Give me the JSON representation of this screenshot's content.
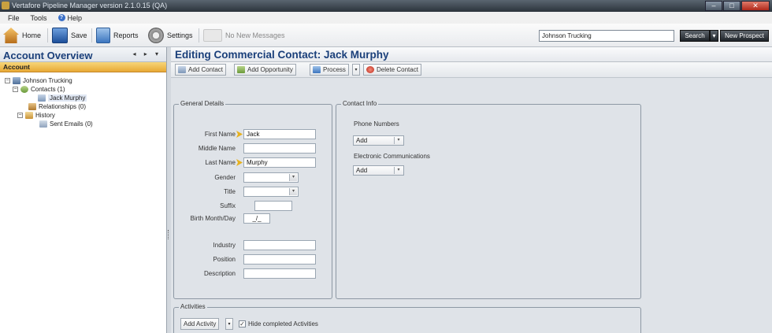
{
  "window": {
    "title": "Vertafore Pipeline Manager version 2.1.0.15 (QA)",
    "controls": {
      "minimize": "–",
      "maximize": "□",
      "close": "✕"
    }
  },
  "menu": {
    "items": [
      "File",
      "Tools",
      "Help"
    ]
  },
  "toolbar": {
    "home": "Home",
    "save": "Save",
    "reports": "Reports",
    "settings": "Settings",
    "messages": "No New Messages",
    "search_value": "Johnson Trucking",
    "search_button": "Search",
    "search_dropdown": "▾",
    "new_prospect": "New Prospect"
  },
  "left_panel": {
    "title": "Account Overview",
    "nav_arrows": "◂ ▸ ▾",
    "section": "Account",
    "tree": {
      "root": "Johnson Trucking",
      "contacts": "Contacts (1)",
      "contact_item": "Jack Murphy",
      "relationships": "Relationships (0)",
      "history": "History",
      "sent_emails": "Sent Emails (0)"
    }
  },
  "main": {
    "title": "Editing Commercial Contact: Jack Murphy",
    "actions": {
      "add_contact": "Add Contact",
      "add_opportunity": "Add Opportunity",
      "process": "Process",
      "process_dropdown": "▾",
      "delete_contact": "Delete Contact"
    },
    "general": {
      "label": "General Details",
      "first_name_label": "First Name",
      "first_name": "Jack",
      "middle_name_label": "Middle Name",
      "middle_name": "",
      "last_name_label": "Last Name",
      "last_name": "Murphy",
      "gender_label": "Gender",
      "title_label": "Title",
      "suffix_label": "Suffix",
      "birth_label": "Birth Month/Day",
      "birth_value": "_/_",
      "industry_label": "Industry",
      "position_label": "Position",
      "description_label": "Description"
    },
    "contact_info": {
      "label": "Contact Info",
      "phone_label": "Phone Numbers",
      "phone_add": "Add",
      "electronic_label": "Electronic Communications",
      "electronic_add": "Add"
    },
    "activities": {
      "label": "Activities",
      "add_activity": "Add Activity",
      "dropdown": "▾",
      "hide_completed": "Hide completed Activities",
      "hide_completed_checked": "✓"
    }
  }
}
